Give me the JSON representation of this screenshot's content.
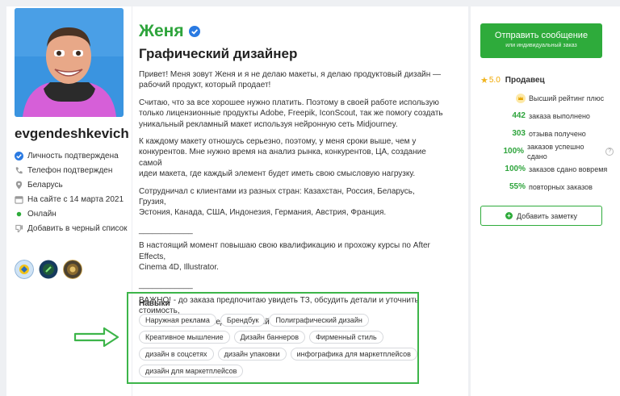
{
  "profile": {
    "username": "evgendeshkevich",
    "name": "Женя",
    "title": "Графический дизайнер",
    "info": [
      {
        "icon": "check-circle-icon",
        "text": "Личность подтверждена"
      },
      {
        "icon": "phone-icon",
        "text": "Телефон подтвержден"
      },
      {
        "icon": "location-icon",
        "text": "Беларусь"
      },
      {
        "icon": "calendar-icon",
        "text": "На сайте с 14 марта 2021"
      },
      {
        "icon": "online-dot-icon",
        "text": "Онлайн"
      },
      {
        "icon": "thumbs-down-icon",
        "text": "Добавить в черный список"
      }
    ],
    "badges": [
      "badge-1-icon",
      "badge-2-icon",
      "badge-3-icon"
    ]
  },
  "description": {
    "paragraphs": [
      "Привет! Меня зовут Женя и я не делаю макеты, я делаю продуктовый дизайн —\nрабочий продукт, который продает!",
      "Считаю, что за все хорошее нужно платить. Поэтому в своей работе использую\nтолько лицензионные продукты Adobe, Freepik, IconScout, так же помогу создать\nуникальный рекламный макет используя нейронную сеть Midjourney.",
      "К каждому макету отношусь серьезно, поэтому, у меня сроки выше, чем у\nконкурентов. Мне нужно время на анализ рынка, конкурентов, ЦА, создание самой\nидеи макета, где каждый элемент будет иметь свою смысловую нагрузку.",
      "Сотрудничал с клиентами из разных стран: Казахстан, Россия, Беларусь, Грузия,\nЭстония, Канада, США, Индонезия, Германия, Австрия, Франция.",
      "____________",
      "В настоящий момент повышаю свою квалификацию и прохожу курсы по After Effects,\nCinema 4D, Illustrator.",
      "____________",
      "ВАЖНО! - до заказа предпочитаю увидеть ТЗ, обсудить детали и уточнить стоимость,\nчтобы не возникло недоразумений после оплаты."
    ]
  },
  "skills": {
    "title": "Навыки",
    "tags": [
      "Наружная реклама",
      "Брендбук",
      "Полиграфический дизайн",
      "Креативное мышление",
      "Дизайн баннеров",
      "Фирменный стиль",
      "дизайн в соцсетях",
      "дизайн упаковки",
      "инфографика для маркетплейсов",
      "дизайн для маркетплейсов"
    ]
  },
  "sidebar": {
    "send_label": "Отправить сообщение",
    "send_sub": "или индивидуальный заказ",
    "rating_value": "5.0",
    "rating_label": "Продавец",
    "top_label": "Высший рейтинг плюс",
    "stats": [
      {
        "num": "442",
        "label": "заказа выполнено",
        "help": false
      },
      {
        "num": "303",
        "label": "отзыва получено",
        "help": false
      },
      {
        "num": "100%",
        "label": "заказов успешно сдано",
        "help": true
      },
      {
        "num": "100%",
        "label": "заказов сдано вовремя",
        "help": false
      },
      {
        "num": "55%",
        "label": "повторных заказов",
        "help": false
      }
    ],
    "note_label": "Добавить заметку"
  },
  "colors": {
    "accent": "#2eab3b",
    "name": "#2ea43c",
    "star": "#f0b41e",
    "highlight": "#3db54a"
  }
}
